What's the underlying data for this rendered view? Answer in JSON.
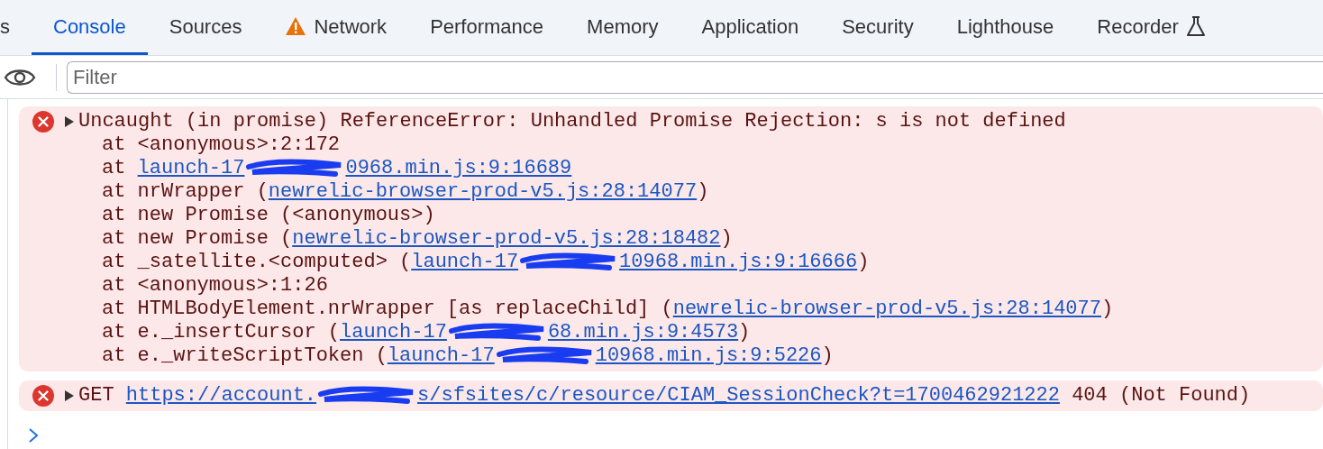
{
  "tabs": [
    {
      "label": "s",
      "selected": false,
      "kind": "plain"
    },
    {
      "label": "Console",
      "selected": true,
      "kind": "plain"
    },
    {
      "label": "Sources",
      "selected": false,
      "kind": "plain"
    },
    {
      "label": "Network",
      "selected": false,
      "kind": "warning"
    },
    {
      "label": "Performance",
      "selected": false,
      "kind": "plain"
    },
    {
      "label": "Memory",
      "selected": false,
      "kind": "plain"
    },
    {
      "label": "Application",
      "selected": false,
      "kind": "plain"
    },
    {
      "label": "Security",
      "selected": false,
      "kind": "plain"
    },
    {
      "label": "Lighthouse",
      "selected": false,
      "kind": "plain"
    },
    {
      "label": "Recorder",
      "selected": false,
      "kind": "experiment"
    }
  ],
  "filter": {
    "placeholder": "Filter"
  },
  "messages": [
    {
      "kind": "error",
      "expanded": false,
      "text": "Uncaught (in promise) ReferenceError: Unhandled Promise Rejection: s is not defined",
      "frames": [
        {
          "before": "at <anonymous>:2:172"
        },
        {
          "before": "at ",
          "link": [
            "launch-17",
            "0968.min.js:9:16689"
          ]
        },
        {
          "before": "at nrWrapper (",
          "link": [
            "newrelic-browser-prod-v5.js:28:14077"
          ],
          "after": ")"
        },
        {
          "before": "at new Promise (<anonymous>)"
        },
        {
          "before": "at new Promise (",
          "link": [
            "newrelic-browser-prod-v5.js:28:18482"
          ],
          "after": ")"
        },
        {
          "before": "at _satellite.<computed> (",
          "link": [
            "launch-17",
            "10968.min.js:9:16666"
          ],
          "after": ")"
        },
        {
          "before": "at <anonymous>:1:26"
        },
        {
          "before": "at HTMLBodyElement.nrWrapper [as replaceChild] (",
          "link": [
            "newrelic-browser-prod-v5.js:28:14077"
          ],
          "after": ")"
        },
        {
          "before": "at e._insertCursor (",
          "link": [
            "launch-17",
            "68.min.js:9:4573"
          ],
          "after": ")"
        },
        {
          "before": "at e._writeScriptToken (",
          "link": [
            "launch-17",
            "10968.min.js:9:5226"
          ],
          "after": ")"
        }
      ]
    },
    {
      "kind": "error",
      "expanded": false,
      "before": "GET ",
      "link": [
        "https://account.",
        "s/sfsites/c/resource/CIAM_SessionCheck?t=1700462921222"
      ],
      "after": " 404 (Not Found)"
    }
  ]
}
